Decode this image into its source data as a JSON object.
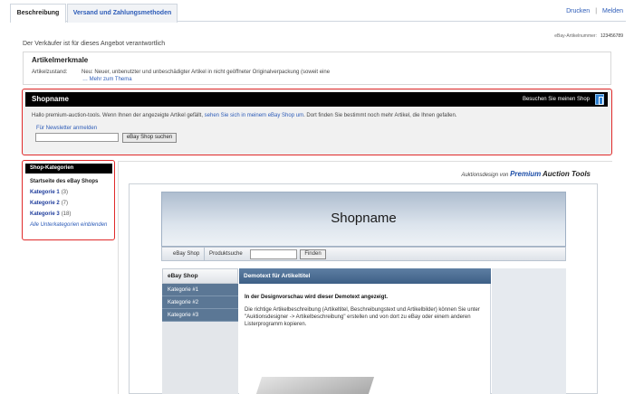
{
  "tabs": [
    {
      "label": "Beschreibung",
      "active": true
    },
    {
      "label": "Versand und Zahlungsmethoden",
      "active": false
    }
  ],
  "top_links": {
    "print": "Drucken",
    "separator": "|",
    "report": "Melden"
  },
  "item_number": {
    "label": "eBay-Artikelnummer:",
    "value": "123456789"
  },
  "seller_note": "Der Verkäufer ist für dieses Angebot verantwortlich",
  "features": {
    "title": "Artikelmerkmale",
    "condition_label": "Artikelzustand:",
    "condition_value": "Neu: Neuer, unbenutzter und unbeschädigter Artikel in nicht geöffneter Originalverpackung (soweit eine",
    "more_link": "Mehr zum Thema"
  },
  "shop": {
    "name": "Shopname",
    "visit_label": "Besuchen Sie meinen Shop",
    "greeting_prefix": "Hallo premium-auction-tools. Wenn Ihnen der angezeigte Artikel gefällt,",
    "greeting_link": "sehen Sie sich in meinem eBay Shop um",
    "greeting_suffix": ". Dort finden Sie bestimmt noch mehr Artikel, die Ihnen gefallen.",
    "newsletter": "Für Newsletter anmelden",
    "search_value": "",
    "search_button": "eBay Shop suchen"
  },
  "categories": {
    "title": "Shop-Kategorien",
    "start": "Startseite des eBay Shops",
    "items": [
      {
        "label": "Kategorie 1",
        "count": "(3)"
      },
      {
        "label": "Kategorie 2",
        "count": "(7)"
      },
      {
        "label": "Kategorie 3",
        "count": "(18)"
      }
    ],
    "show_all": "Alle Unterkategorien einblenden"
  },
  "credit": {
    "prefix": "Auktionsdesign von",
    "brand": "Premium",
    "brand2": "Auction Tools"
  },
  "template": {
    "banner_title": "Shopname",
    "nav_shop": "eBay Shop",
    "nav_search_label": "Produktsuche",
    "nav_search_value": "",
    "nav_find": "Finden",
    "side_title": "eBay Shop",
    "side_items": [
      "Kategorie #1",
      "Kategorie #2",
      "Kategorie #3"
    ],
    "content_title": "Demotext für Artikeltitel",
    "content_lead": "In der Designvorschau wird dieser Demotext angezeigt.",
    "content_body": "Die richtige Artikelbeschreibung (Artikeltitel, Beschreibungstext und Artikelbilder) können Sie unter \"Auktionsdesigner -> Artikelbeschreibung\" erstellen und von dort zu eBay oder einem anderen Listerprogramm kopieren."
  },
  "colors": {
    "accent_link": "#2d5cb8",
    "highlight_border": "#e02a2a",
    "header_bg": "#000000",
    "nav_blue": "#5b7795"
  }
}
